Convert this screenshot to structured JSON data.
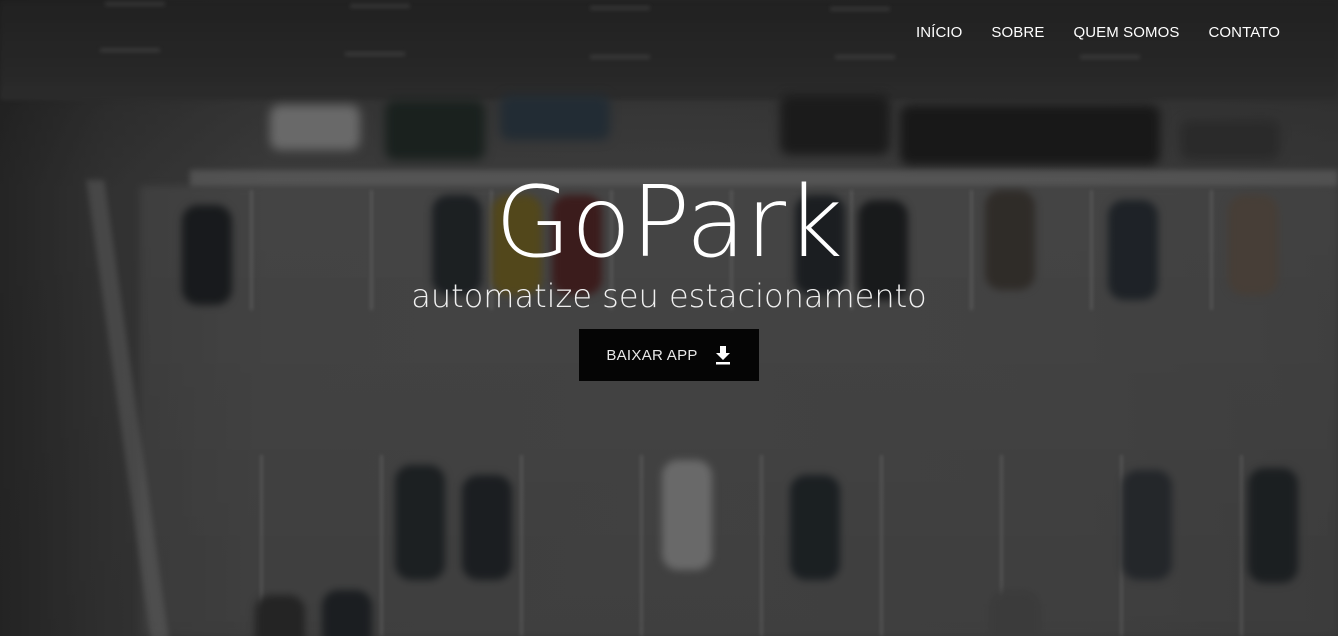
{
  "nav": {
    "items": [
      {
        "label": "INÍCIO"
      },
      {
        "label": "SOBRE"
      },
      {
        "label": "QUEM SOMOS"
      },
      {
        "label": "CONTATO"
      }
    ]
  },
  "hero": {
    "title": "GoPark",
    "tagline": "automatize seu estacionamento",
    "cta_label": "BAIXAR APP",
    "cta_icon": "download-icon"
  },
  "colors": {
    "text": "#ffffff",
    "button_bg": "#050505",
    "overlay": "#141414"
  }
}
